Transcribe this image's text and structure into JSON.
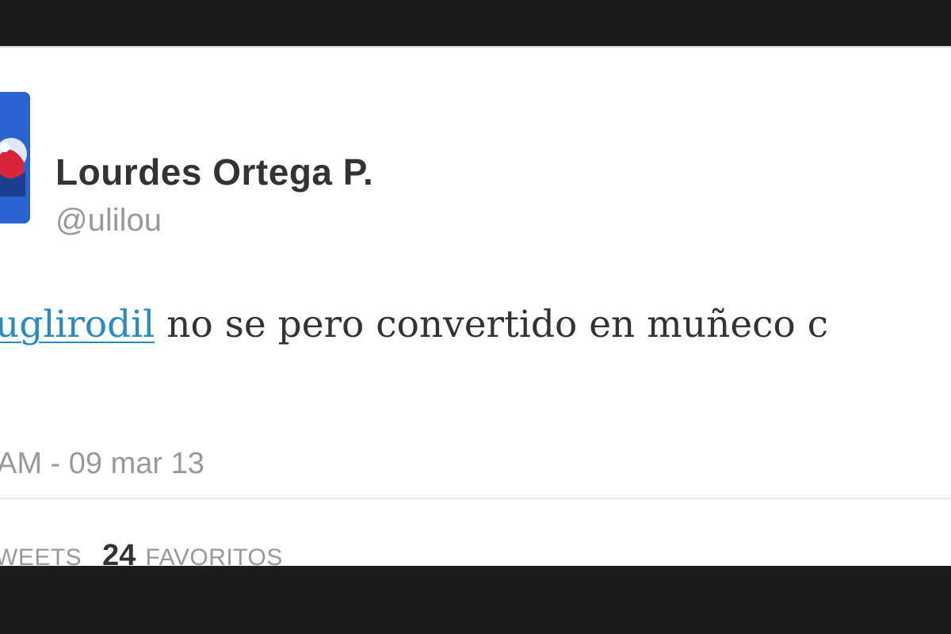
{
  "tweet": {
    "display_name": "Lourdes Ortega P.",
    "handle": "@ulilou",
    "mention": "uglirodil",
    "text": " no se pero convertido en muñeco c",
    "timestamp": "AM - 09 mar 13",
    "retweets_label": "WEETS",
    "favorites_count": "24",
    "favorites_label": "FAVORITOS"
  },
  "avatar": {
    "icon": "profile-photo-icon"
  },
  "colors": {
    "background_bar": "#1c1c1c",
    "card": "#ffffff",
    "name_text": "#333333",
    "meta_text": "#999999",
    "link": "#2a8bc2"
  }
}
